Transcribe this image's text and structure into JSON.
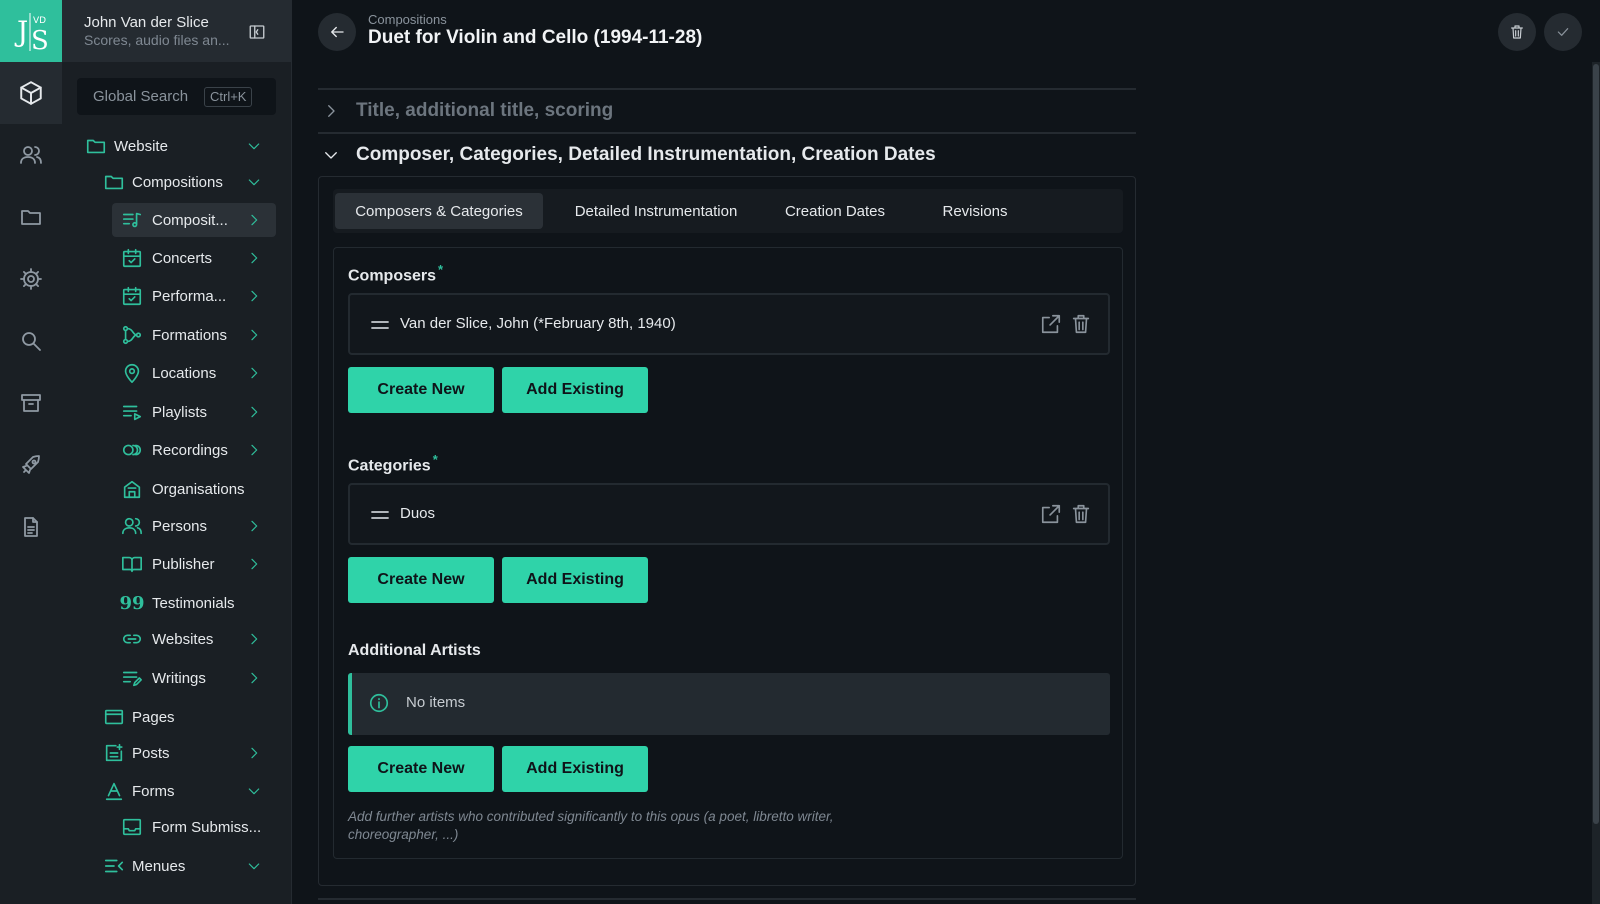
{
  "brand": {
    "logo_text": "JVdS",
    "accent": "#2fbf9c",
    "button_color": "#2fd3a9"
  },
  "user": {
    "name": "John Van der Slice",
    "subtitle": "Scores, audio files an..."
  },
  "search": {
    "placeholder": "Global Search",
    "shortcut": "Ctrl+K"
  },
  "rail": [
    {
      "icon": "cube-icon",
      "active": true
    },
    {
      "icon": "users-icon"
    },
    {
      "icon": "folder-icon"
    },
    {
      "icon": "gear-icon"
    },
    {
      "icon": "search-icon"
    },
    {
      "icon": "archive-icon"
    },
    {
      "icon": "rocket-icon"
    },
    {
      "icon": "document-icon"
    }
  ],
  "nav": {
    "website": "Website",
    "compositions_folder": "Compositions",
    "compositions": "Composit...",
    "concerts": "Concerts",
    "performances": "Performa...",
    "formations": "Formations",
    "locations": "Locations",
    "playlists": "Playlists",
    "recordings": "Recordings",
    "organisations": "Organisations",
    "persons": "Persons",
    "publisher": "Publisher",
    "testimonials": "Testimonials",
    "websites": "Websites",
    "writings": "Writings",
    "pages": "Pages",
    "posts": "Posts",
    "forms": "Forms",
    "form_submissions": "Form Submiss...",
    "menues": "Menues"
  },
  "header": {
    "breadcrumb": "Compositions",
    "title": "Duet for Violin and Cello (1994-11-28)"
  },
  "sections": {
    "collapsed": "Title, additional title, scoring",
    "expanded": "Composer, Categories, Detailed Instrumentation, Creation Dates"
  },
  "tabs": [
    "Composers & Categories",
    "Detailed Instrumentation",
    "Creation Dates",
    "Revisions"
  ],
  "composers": {
    "label": "Composers",
    "required": "*",
    "items": [
      "Van der Slice, John (*February 8th, 1940)"
    ]
  },
  "categories": {
    "label": "Categories",
    "required": "*",
    "items": [
      "Duos"
    ]
  },
  "artists": {
    "label": "Additional Artists",
    "empty": "No items",
    "help": "Add further artists who contributed significantly to this opus (a poet, libretto writer, choreographer, ...)"
  },
  "buttons": {
    "create": "Create New",
    "add": "Add Existing"
  }
}
